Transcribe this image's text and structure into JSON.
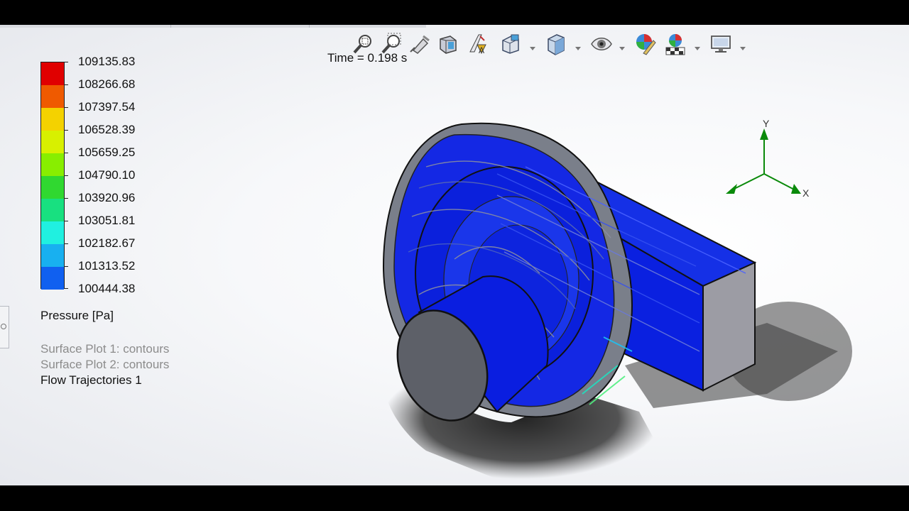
{
  "legend": {
    "title": "Pressure [Pa]",
    "values": [
      "109135.83",
      "108266.68",
      "107397.54",
      "106528.39",
      "105659.25",
      "104790.10",
      "103920.96",
      "103051.81",
      "102182.67",
      "101313.52",
      "100444.38"
    ],
    "colors": [
      "#e00000",
      "#ef5a00",
      "#f4d200",
      "#d8f000",
      "#88ee00",
      "#30d830",
      "#18e080",
      "#20f0e0",
      "#18b0f0",
      "#1060f0",
      "#0010f0"
    ]
  },
  "time_label": "Time = 0.198 s",
  "plots": [
    {
      "label": "Surface Plot 1: contours",
      "active": false
    },
    {
      "label": "Surface Plot 2: contours",
      "active": false
    },
    {
      "label": "Flow Trajectories 1",
      "active": true
    }
  ],
  "triad": {
    "y": "Y",
    "x": "X"
  },
  "toolbar": {
    "icons": [
      "zoom-to-fit-icon",
      "zoom-to-area-icon",
      "previous-view-icon",
      "section-view-icon",
      "dynamic-annotation-icon",
      "view-orientation-icon",
      "display-style-icon",
      "hide-show-items-icon",
      "edit-appearance-icon",
      "apply-scene-icon",
      "view-settings-icon"
    ]
  }
}
